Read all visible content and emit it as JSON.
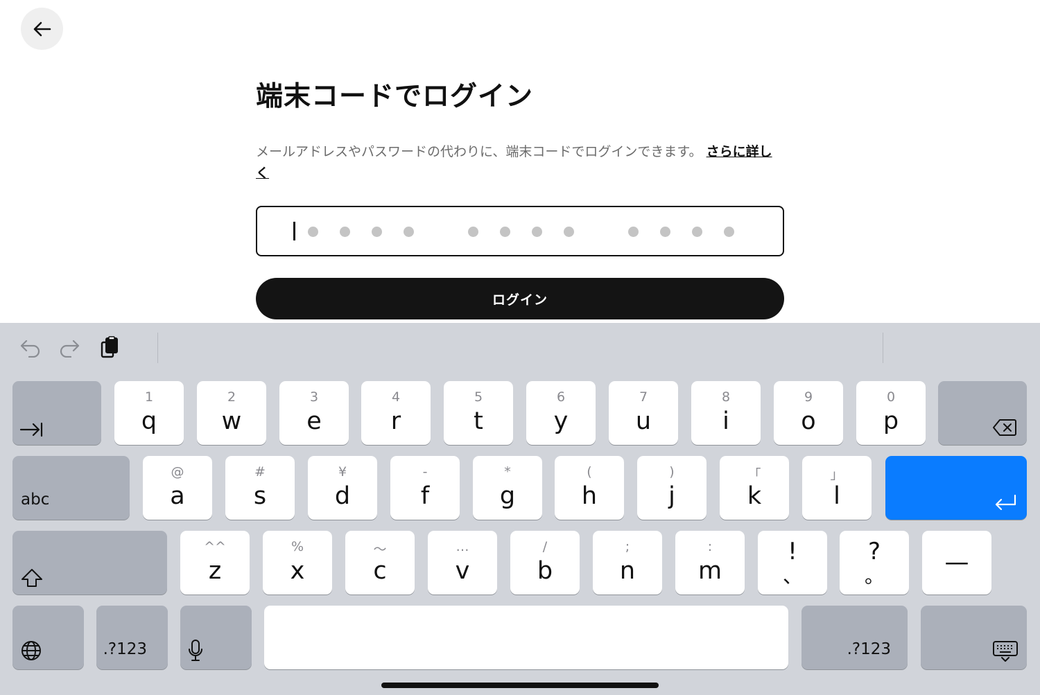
{
  "page": {
    "title": "端末コードでログイン",
    "description": "メールアドレスやパスワードの代わりに、端末コードでログインできます。",
    "learn_more": "さらに詳しく",
    "code_field": {
      "value": "",
      "placeholder_dots": 12
    },
    "login_button": "ログイン"
  },
  "keyboard": {
    "row1": [
      {
        "sub": "1",
        "main": "q"
      },
      {
        "sub": "2",
        "main": "w"
      },
      {
        "sub": "3",
        "main": "e"
      },
      {
        "sub": "4",
        "main": "r"
      },
      {
        "sub": "5",
        "main": "t"
      },
      {
        "sub": "6",
        "main": "y"
      },
      {
        "sub": "7",
        "main": "u"
      },
      {
        "sub": "8",
        "main": "i"
      },
      {
        "sub": "9",
        "main": "o"
      },
      {
        "sub": "0",
        "main": "p"
      }
    ],
    "row2_label": "abc",
    "row2": [
      {
        "sub": "@",
        "main": "a"
      },
      {
        "sub": "#",
        "main": "s"
      },
      {
        "sub": "¥",
        "main": "d"
      },
      {
        "sub": "-",
        "main": "f"
      },
      {
        "sub": "*",
        "main": "g"
      },
      {
        "sub": "(",
        "main": "h"
      },
      {
        "sub": ")",
        "main": "j"
      },
      {
        "sub": "「",
        "main": "k"
      },
      {
        "sub": "」",
        "main": "l"
      }
    ],
    "row3": [
      {
        "sub": "^^",
        "main": "z"
      },
      {
        "sub": "%",
        "main": "x"
      },
      {
        "sub": "〜",
        "main": "c"
      },
      {
        "sub": "…",
        "main": "v"
      },
      {
        "sub": "/",
        "main": "b"
      },
      {
        "sub": ";",
        "main": "n"
      },
      {
        "sub": ":",
        "main": "m"
      },
      {
        "sub": "!",
        "main": "、"
      },
      {
        "sub": "?",
        "main": "。"
      },
      {
        "sub": "",
        "main": "—"
      }
    ],
    "numbers_label_left": ".?123",
    "numbers_label_right": ".?123",
    "accent_color": "#0a7cff"
  }
}
